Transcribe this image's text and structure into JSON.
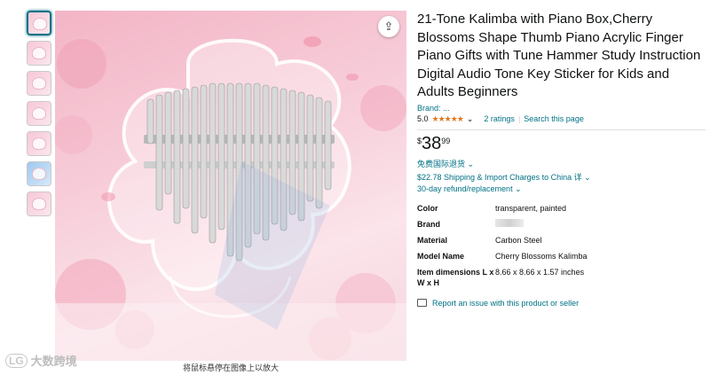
{
  "product": {
    "title": "21-Tone Kalimba with Piano Box,Cherry Blossoms Shape Thumb Piano Acrylic Finger Piano Gifts with Tune Hammer Study Instruction Digital Audio Tone Key Sticker for Kids and Adults Beginners",
    "brand_label": "Brand: ...",
    "rating_value": "5.0",
    "rating_stars": "★★★★★",
    "rating_fraction": 1.0,
    "ratings_link": "2 ratings",
    "search_link": "Search this page",
    "price_symbol": "$",
    "price_whole": "38",
    "price_fraction": "99",
    "free_return": "免费国际退货",
    "shipping": "$22.78 Shipping & Import Charges to China",
    "shipping_detail": "详",
    "refund": "30-day refund/replacement"
  },
  "specs": [
    {
      "key": "Color",
      "value": "transparent, painted"
    },
    {
      "key": "Brand",
      "value": ""
    },
    {
      "key": "Material",
      "value": "Carbon Steel"
    },
    {
      "key": "Model Name",
      "value": "Cherry Blossoms Kalimba"
    },
    {
      "key": "Item dimensions L x W x H",
      "value": "8.66 x 8.66 x 1.57 inches"
    }
  ],
  "report_link": "Report an issue with this product or seller",
  "image_hint": "将鼠标悬停在图像上以放大",
  "watermark_logo": "大数跨境",
  "colors": {
    "link": "#007185",
    "star": "#de7921",
    "accent": "#007185"
  }
}
